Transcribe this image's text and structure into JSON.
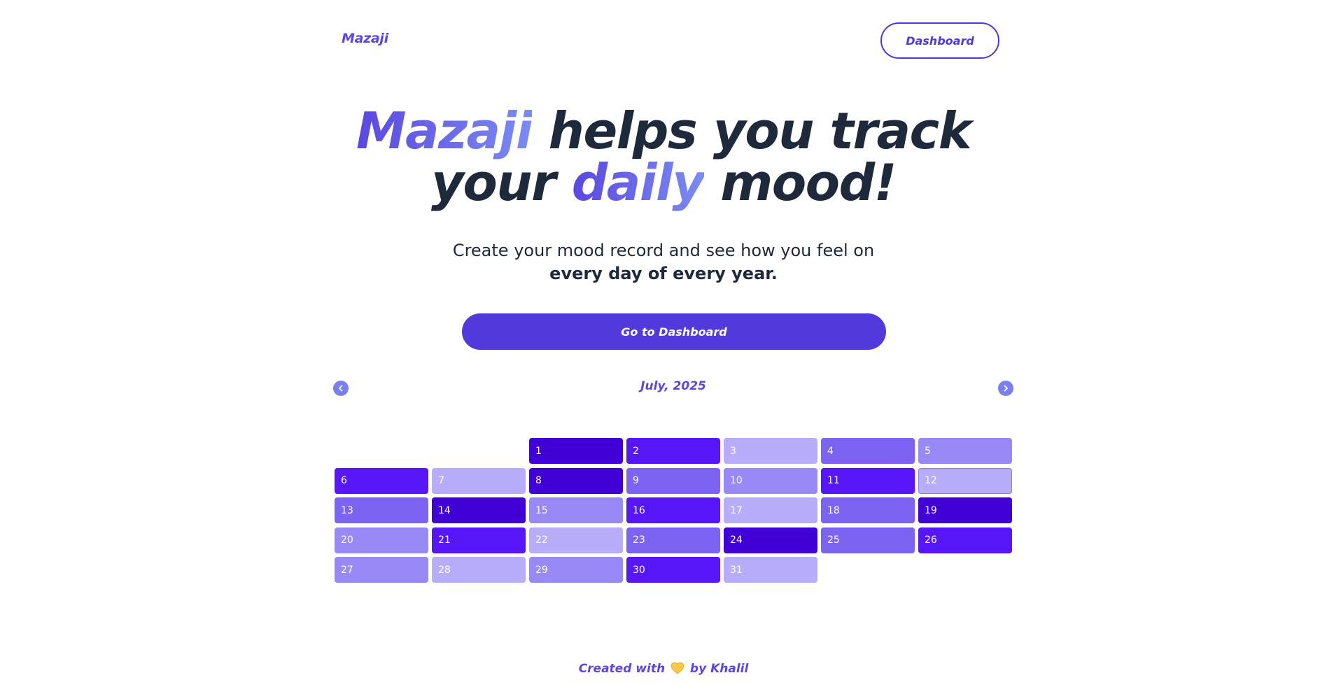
{
  "header": {
    "logo": "Mazaji",
    "nav_button": "Dashboard"
  },
  "hero": {
    "title_part1": "Mazaji",
    "title_part2": " helps you track",
    "title_part3": "your ",
    "title_part4": "daily",
    "title_part5": " mood!",
    "subtitle_line1": "Create your mood record and see how you feel on",
    "subtitle_line2": "every day of every year.",
    "cta_label": "Go to Dashboard"
  },
  "calendar": {
    "month_label": "July, 2025",
    "prev_icon": "chevron-left-icon",
    "next_icon": "chevron-right-icon",
    "leading_empty_days": 2,
    "today": 12,
    "mood_colors": {
      "1": "#b8adfb",
      "2": "#978af7",
      "3": "#7c63f2",
      "4": "#5716f8",
      "5": "#4000d6"
    },
    "days": [
      {
        "day": "1",
        "mood": 5
      },
      {
        "day": "2",
        "mood": 4
      },
      {
        "day": "3",
        "mood": 1
      },
      {
        "day": "4",
        "mood": 3
      },
      {
        "day": "5",
        "mood": 2
      },
      {
        "day": "6",
        "mood": 4
      },
      {
        "day": "7",
        "mood": 1
      },
      {
        "day": "8",
        "mood": 5
      },
      {
        "day": "9",
        "mood": 3
      },
      {
        "day": "10",
        "mood": 2
      },
      {
        "day": "11",
        "mood": 4
      },
      {
        "day": "12",
        "mood": 1
      },
      {
        "day": "13",
        "mood": 3
      },
      {
        "day": "14",
        "mood": 5
      },
      {
        "day": "15",
        "mood": 2
      },
      {
        "day": "16",
        "mood": 4
      },
      {
        "day": "17",
        "mood": 1
      },
      {
        "day": "18",
        "mood": 3
      },
      {
        "day": "19",
        "mood": 5
      },
      {
        "day": "20",
        "mood": 2
      },
      {
        "day": "21",
        "mood": 4
      },
      {
        "day": "22",
        "mood": 1
      },
      {
        "day": "23",
        "mood": 3
      },
      {
        "day": "24",
        "mood": 5
      },
      {
        "day": "25",
        "mood": 3
      },
      {
        "day": "26",
        "mood": 4
      },
      {
        "day": "27",
        "mood": 2
      },
      {
        "day": "28",
        "mood": 1
      },
      {
        "day": "29",
        "mood": 2
      },
      {
        "day": "30",
        "mood": 4
      },
      {
        "day": "31",
        "mood": 1
      }
    ]
  },
  "footer": {
    "prefix": "Created with",
    "icon": "yellow-heart-icon",
    "suffix": "by Khalil"
  }
}
